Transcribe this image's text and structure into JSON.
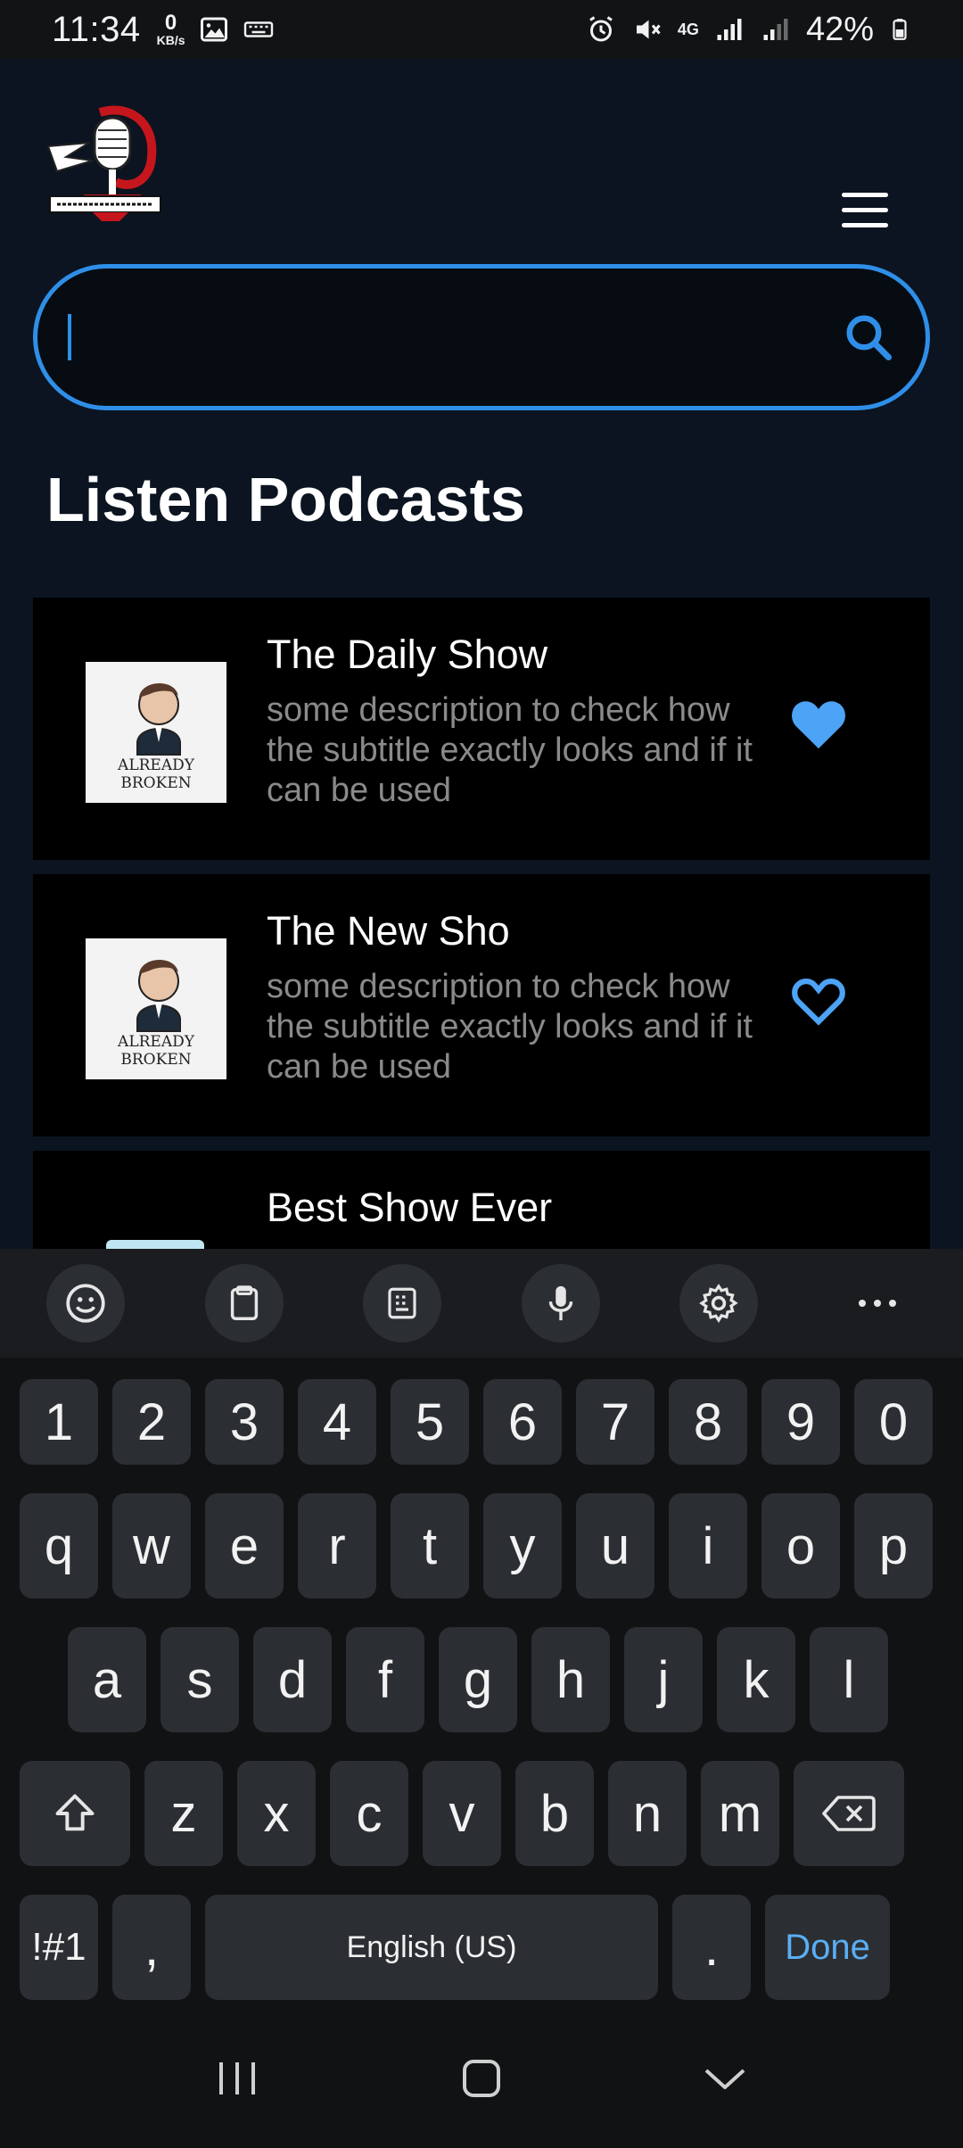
{
  "status_bar": {
    "time": "11:34",
    "data_rate_value": "0",
    "data_rate_unit": "KB/s",
    "network": "4G",
    "battery": "42%"
  },
  "header": {
    "logo_icon": "microphone-logo",
    "menu_icon": "hamburger-menu-icon"
  },
  "search": {
    "value": "",
    "placeholder": "",
    "icon": "search-icon"
  },
  "section_title": "Listen Podcasts",
  "podcasts": [
    {
      "title": "The Daily Show",
      "description": "some description to check how the subtitle exactly looks and if it can be used",
      "thumb_text": "ALREADY BROKEN",
      "favorite": true
    },
    {
      "title": "The New Sho",
      "description": "some description to check how the subtitle exactly looks and if it can be used",
      "thumb_text": "ALREADY BROKEN",
      "favorite": false
    },
    {
      "title": "Best Show Ever",
      "description": "",
      "thumb_text": "",
      "favorite": false
    }
  ],
  "colors": {
    "accent": "#2f8fe8",
    "background": "#0b1420",
    "card": "#000000",
    "favorite": "#4da3f5"
  },
  "keyboard": {
    "toolbar": [
      "emoji-icon",
      "clipboard-icon",
      "keypad-icon",
      "microphone-icon",
      "settings-icon",
      "more-icon"
    ],
    "row1": [
      "1",
      "2",
      "3",
      "4",
      "5",
      "6",
      "7",
      "8",
      "9",
      "0"
    ],
    "row2": [
      "q",
      "w",
      "e",
      "r",
      "t",
      "y",
      "u",
      "i",
      "o",
      "p"
    ],
    "row3": [
      "a",
      "s",
      "d",
      "f",
      "g",
      "h",
      "j",
      "k",
      "l"
    ],
    "row4": [
      "z",
      "x",
      "c",
      "v",
      "b",
      "n",
      "m"
    ],
    "symbols_label": "!#1",
    "comma_label": ",",
    "space_label": "English (US)",
    "period_label": ".",
    "done_label": "Done"
  },
  "nav_bar": [
    "recent-apps-icon",
    "home-icon",
    "back-icon"
  ]
}
